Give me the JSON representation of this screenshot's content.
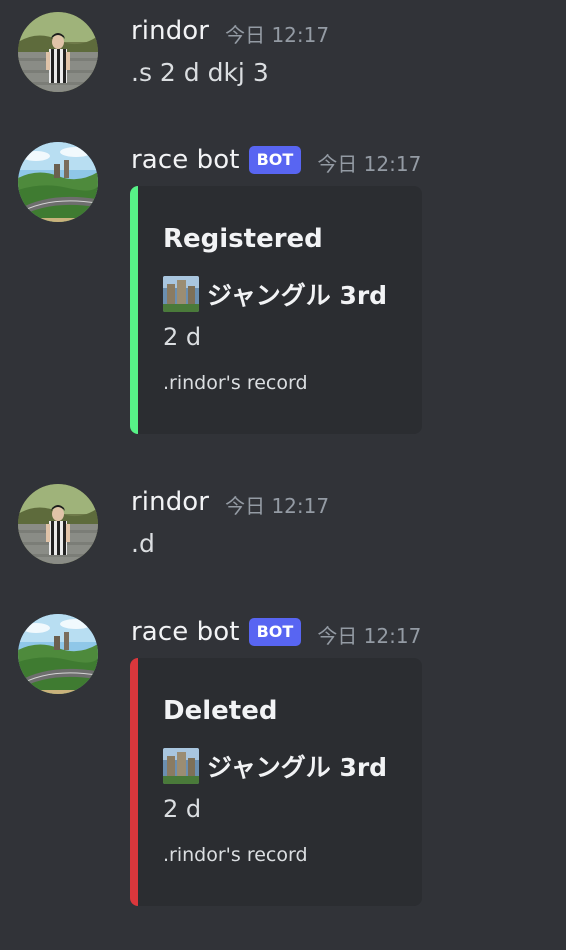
{
  "colors": {
    "background": "#313338",
    "embed_background": "#2b2d31",
    "bot_tag": "#5865f2",
    "registered_bar": "#57f287",
    "deleted_bar": "#da373c"
  },
  "messages": [
    {
      "author": "rindor",
      "timestamp": "今日 12:17",
      "text": ".s 2 d dkj 3",
      "avatar_icon": "user-avatar-photo"
    },
    {
      "author": "race bot",
      "bot_tag": "BOT",
      "timestamp": "今日 12:17",
      "avatar_icon": "race-track-avatar",
      "embed": {
        "title": "Registered",
        "bar_color": "#57f287",
        "field_name": "ジャングル 3rd",
        "field_icon": "track-thumbnail-icon",
        "field_value": "2 d",
        "footer": ".rindor's record"
      }
    },
    {
      "author": "rindor",
      "timestamp": "今日 12:17",
      "text": ".d",
      "avatar_icon": "user-avatar-photo"
    },
    {
      "author": "race bot",
      "bot_tag": "BOT",
      "timestamp": "今日 12:17",
      "avatar_icon": "race-track-avatar",
      "embed": {
        "title": "Deleted",
        "bar_color": "#da373c",
        "field_name": "ジャングル 3rd",
        "field_icon": "track-thumbnail-icon",
        "field_value": "2 d",
        "footer": ".rindor's record"
      }
    }
  ]
}
